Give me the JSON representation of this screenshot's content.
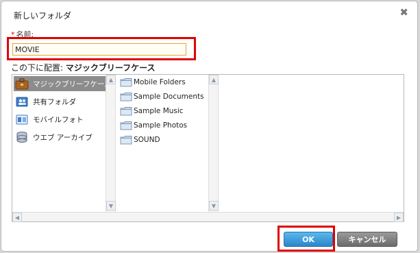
{
  "dialog": {
    "title": "新しいフォルダ",
    "close_glyph": "✖",
    "name_label": "名前:",
    "required_mark": "*",
    "name_value": "MOVIE",
    "destination_label": "この下に配置:",
    "destination_value": "マジックブリーフケース"
  },
  "locations": [
    {
      "label": "マジックブリーフケース",
      "icon": "briefcase-icon",
      "selected": true
    },
    {
      "label": "共有フォルダ",
      "icon": "shared-folder-icon",
      "selected": false
    },
    {
      "label": "モバイルフォト",
      "icon": "mobile-photo-icon",
      "selected": false
    },
    {
      "label": "ウエブ アーカイブ",
      "icon": "web-archive-icon",
      "selected": false
    }
  ],
  "folders": [
    {
      "label": "Mobile Folders",
      "icon": "folder-icon"
    },
    {
      "label": "Sample Documents",
      "icon": "folder-icon"
    },
    {
      "label": "Sample Music",
      "icon": "folder-icon"
    },
    {
      "label": "Sample Photos",
      "icon": "folder-icon"
    },
    {
      "label": "SOUND",
      "icon": "folder-icon"
    }
  ],
  "buttons": {
    "ok": "OK",
    "cancel": "キャンセル"
  },
  "colors": {
    "highlight_box": "#e00000",
    "ok_button": "#2b86c9",
    "cancel_button": "#6b6b6b",
    "selected_row": "#8c8c8c"
  }
}
